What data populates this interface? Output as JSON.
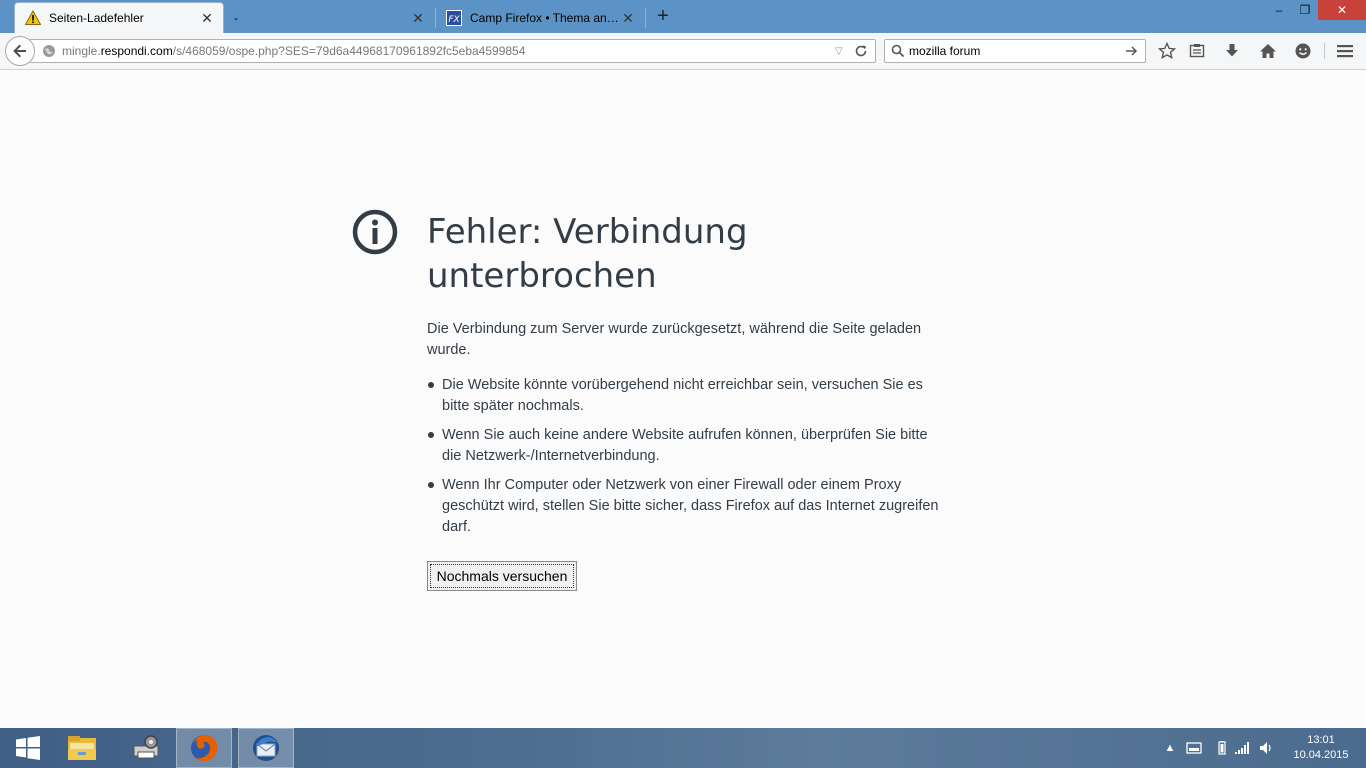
{
  "tabs": [
    {
      "label": "Seiten-Ladefehler",
      "icon": "warning-icon",
      "active": true
    },
    {
      "label": "-",
      "icon": "",
      "active": false
    },
    {
      "label": "Camp Firefox • Thema anz...",
      "icon": "camp-firefox-icon",
      "active": false
    }
  ],
  "newtab": {
    "label": "+"
  },
  "window": {
    "minimize": "‒",
    "maximize": "❐",
    "close": "✕"
  },
  "urlbar": {
    "prefix": "mingle.",
    "host": "respondi.com",
    "path": "/s/468059/ospe.php?SES=79d6a44968170961892fc5eba4599854"
  },
  "search": {
    "value": "mozilla forum"
  },
  "error": {
    "title": "Fehler: Verbindung unterbrochen",
    "description": "Die Verbindung zum Server wurde zurückgesetzt, während die Seite geladen wurde.",
    "items": [
      "Die Website könnte vorübergehend nicht erreichbar sein, versuchen Sie es bitte später nochmals.",
      "Wenn Sie auch keine andere Website aufrufen können, überprüfen Sie bitte die Netzwerk-/Internetverbindung.",
      "Wenn Ihr Computer oder Netzwerk von einer Firewall oder einem Proxy geschützt wird, stellen Sie bitte sicher, dass Firefox auf das Internet zugreifen darf."
    ],
    "retry_label": "Nochmals versuchen"
  },
  "taskbar": {
    "time": "13:01",
    "date": "10.04.2015"
  },
  "colors": {
    "titlebar": "#5b93c6",
    "text": "#333d47",
    "close": "#c8413a"
  }
}
